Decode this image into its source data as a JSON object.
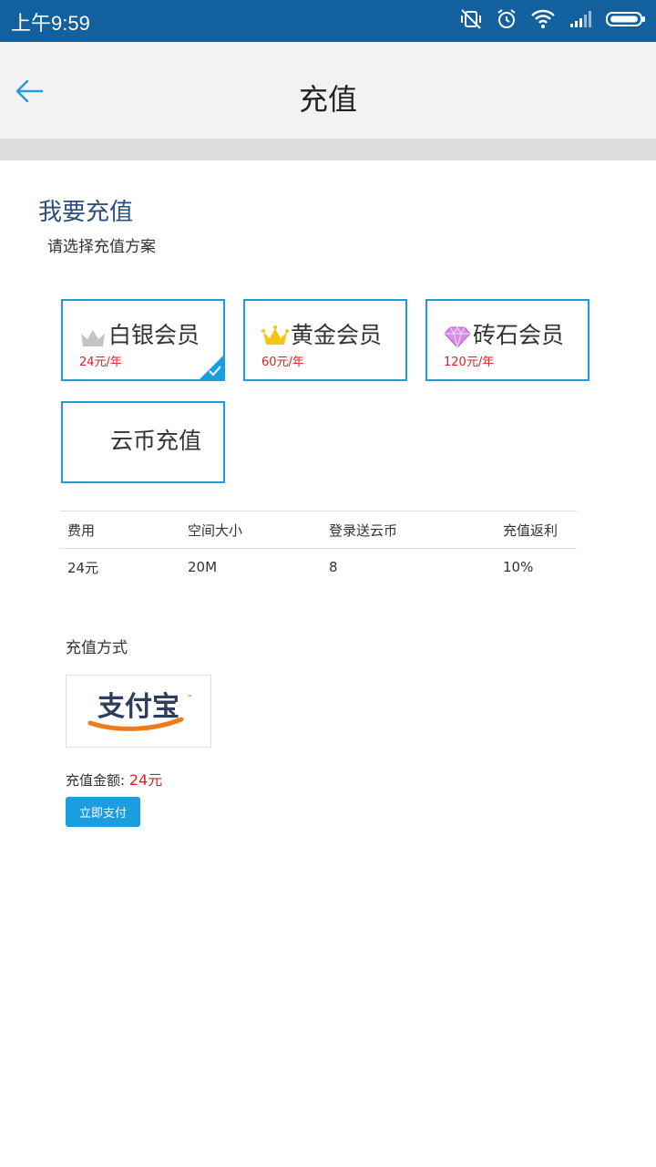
{
  "status_bar": {
    "time": "上午9:59"
  },
  "header": {
    "title": "充值"
  },
  "section": {
    "title": "我要充值",
    "subtitle": "请选择充值方案"
  },
  "plans": [
    {
      "name": "白银会员",
      "price": "24元/年",
      "icon": "silver-crown-icon",
      "selected": true
    },
    {
      "name": "黄金会员",
      "price": "60元/年",
      "icon": "gold-crown-icon",
      "selected": false
    },
    {
      "name": "砖石会员",
      "price": "120元/年",
      "icon": "diamond-icon",
      "selected": false
    },
    {
      "name": "云币充值",
      "price": "",
      "icon": "",
      "selected": false
    }
  ],
  "table": {
    "headers": [
      "费用",
      "空间大小",
      "登录送云币",
      "充值返利"
    ],
    "row": [
      "24元",
      "20M",
      "8",
      "10%"
    ]
  },
  "payment": {
    "label": "充值方式",
    "method_logo_text": "支付宝",
    "amount_label": "充值金额:",
    "amount_value": "24元",
    "pay_button": "立即支付"
  },
  "colors": {
    "status_bar": "#13609f",
    "accent": "#1a9ee0",
    "price_red": "#e02020",
    "section_title": "#2c4f7c"
  }
}
